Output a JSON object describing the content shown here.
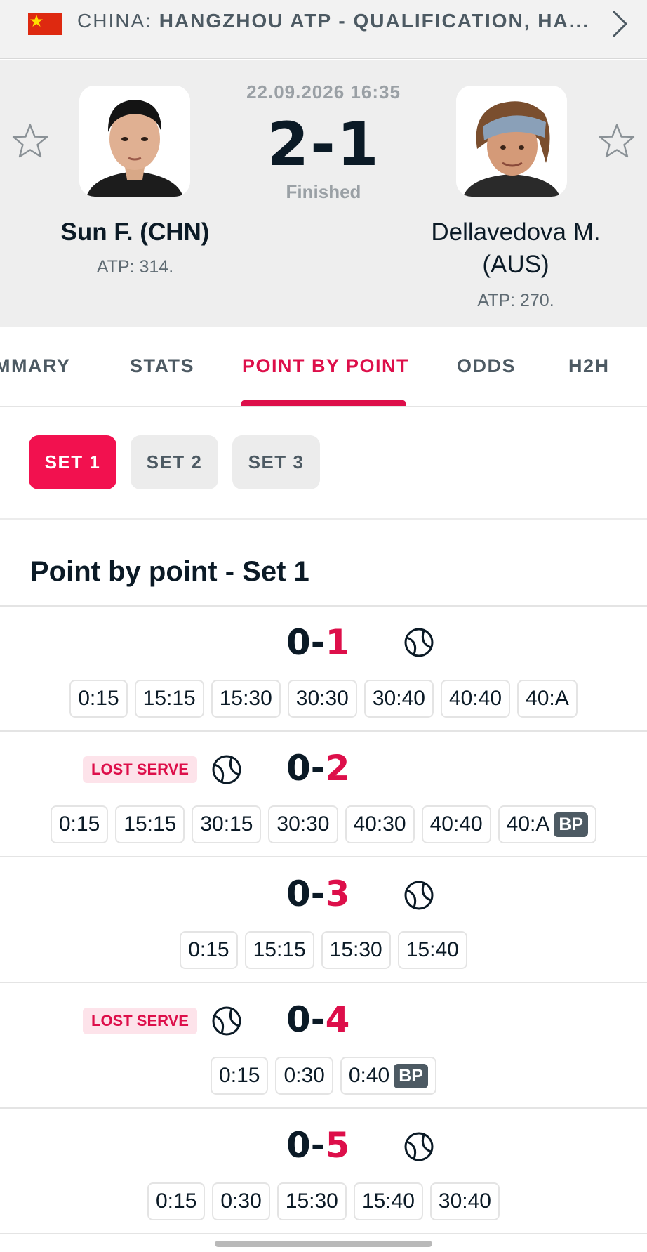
{
  "header": {
    "country": "CHINA:",
    "competition": "HANGZHOU ATP - QUALIFICATION, HA..."
  },
  "match": {
    "datetime": "22.09.2026 16:35",
    "score": "2-1",
    "status": "Finished",
    "home": {
      "name": "Sun F. (CHN)",
      "rank": "ATP: 314."
    },
    "away": {
      "name": "Dellavedova M. (AUS)",
      "rank": "ATP: 270."
    }
  },
  "tabs": [
    "MMARY",
    "STATS",
    "POINT BY POINT",
    "ODDS",
    "H2H"
  ],
  "sets": [
    "SET 1",
    "SET 2",
    "SET 3"
  ],
  "section_title": "Point by point - Set 1",
  "games": [
    {
      "home": "0",
      "sep": "-",
      "away": "1",
      "lost_serve": "",
      "points": [
        "0:15",
        "15:15",
        "15:30",
        "30:30",
        "30:40",
        "40:40",
        "40:A"
      ],
      "bp": ""
    },
    {
      "home": "0",
      "sep": "-",
      "away": "2",
      "lost_serve": "LOST SERVE",
      "points": [
        "0:15",
        "15:15",
        "30:15",
        "30:30",
        "40:30",
        "40:40",
        "40:A"
      ],
      "bp": "BP"
    },
    {
      "home": "0",
      "sep": "-",
      "away": "3",
      "lost_serve": "",
      "points": [
        "0:15",
        "15:15",
        "15:30",
        "15:40"
      ],
      "bp": ""
    },
    {
      "home": "0",
      "sep": "-",
      "away": "4",
      "lost_serve": "LOST SERVE",
      "points": [
        "0:15",
        "0:30",
        "0:40"
      ],
      "bp": "BP"
    },
    {
      "home": "0",
      "sep": "-",
      "away": "5",
      "lost_serve": "",
      "points": [
        "0:15",
        "0:30",
        "15:30",
        "15:40",
        "30:40"
      ],
      "bp": ""
    }
  ],
  "colors": {
    "accent": "#dd0f4a",
    "chip_active": "#f2114f",
    "text": "#0b1a26",
    "muted": "#4d5a63"
  }
}
